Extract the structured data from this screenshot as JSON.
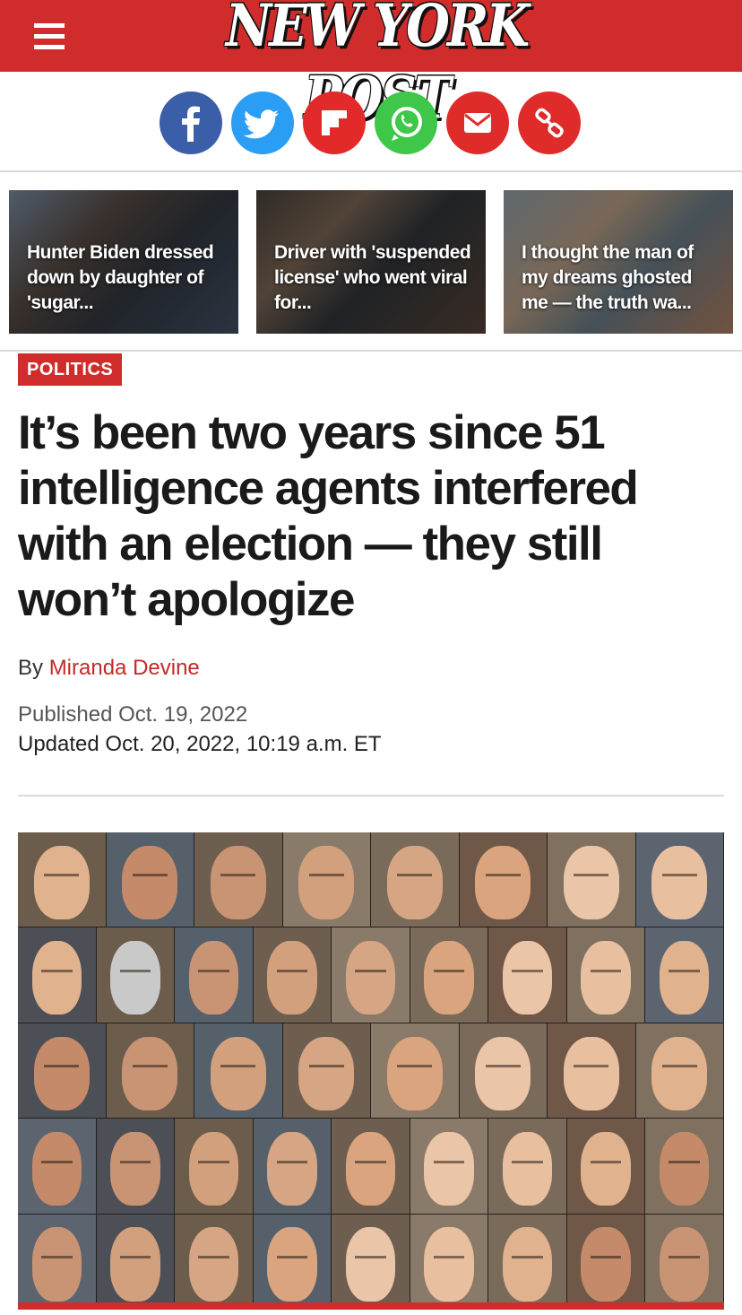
{
  "header": {
    "logo_text": "NEW YORK POST",
    "menu_icon": "hamburger-menu-icon",
    "brand_color": "#d12c2c"
  },
  "share": {
    "buttons": [
      {
        "icon": "facebook-icon",
        "color": "#3b5ea8"
      },
      {
        "icon": "twitter-icon",
        "color": "#2a9df4"
      },
      {
        "icon": "flipboard-icon",
        "color": "#e32a2a"
      },
      {
        "icon": "whatsapp-icon",
        "color": "#3ec749"
      },
      {
        "icon": "email-icon",
        "color": "#e02b2b"
      },
      {
        "icon": "link-icon",
        "color": "#e02b2b"
      }
    ]
  },
  "related": {
    "items": [
      {
        "title": "Hunter Biden dressed down by daughter of 'sugar..."
      },
      {
        "title": "Driver with 'suspended license' who went viral for..."
      },
      {
        "title": "I thought the man of my dreams ghosted me — the truth wa..."
      }
    ]
  },
  "article": {
    "section": "POLITICS",
    "headline": "It’s been two years since 51 intelligence agents interfered with an election — they still won’t apologize",
    "byline_prefix": "By ",
    "author": "Miranda Devine",
    "published": "Published Oct. 19, 2022",
    "updated": "Updated Oct. 20, 2022, 10:19 a.m. ET"
  }
}
